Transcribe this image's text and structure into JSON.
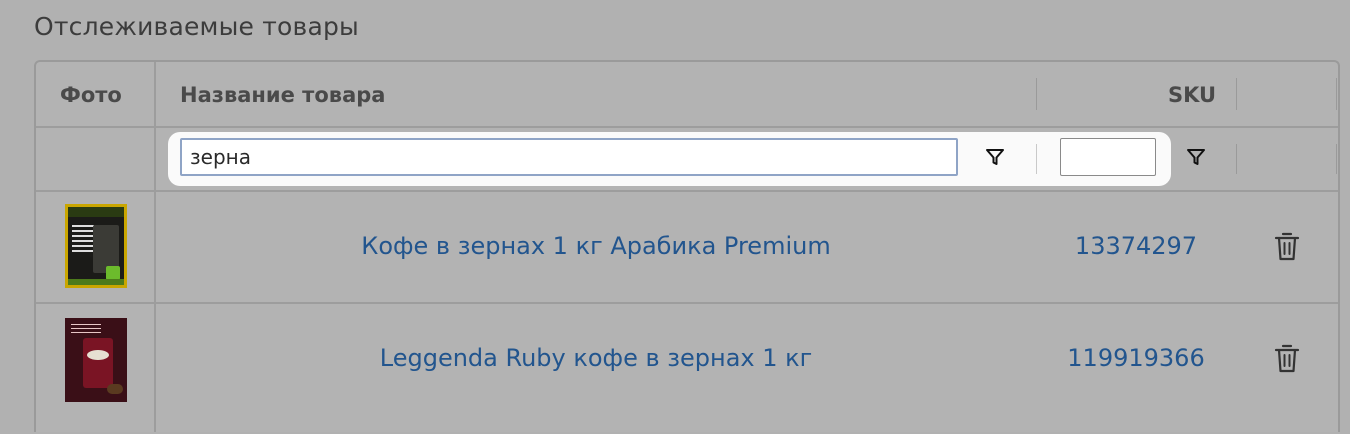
{
  "section": {
    "title": "Отслеживаемые товары"
  },
  "grid": {
    "columns": {
      "photo": "Фото",
      "name": "Название товара",
      "sku": "SKU",
      "actions": ""
    },
    "filters": {
      "name_value": "зерна",
      "sku_value": ""
    },
    "rows": [
      {
        "name": "Кофе в зернах 1 кг Арабика Premium",
        "sku": "13374297"
      },
      {
        "name": "Leggenda Ruby кофе в зернах 1 кг",
        "sku": "119919366"
      }
    ]
  },
  "colors": {
    "link": "#22558e",
    "background": "#b1b1b1",
    "highlight": "#fafafa"
  },
  "icons": {
    "filter": "filter-icon",
    "delete": "trash-icon"
  }
}
